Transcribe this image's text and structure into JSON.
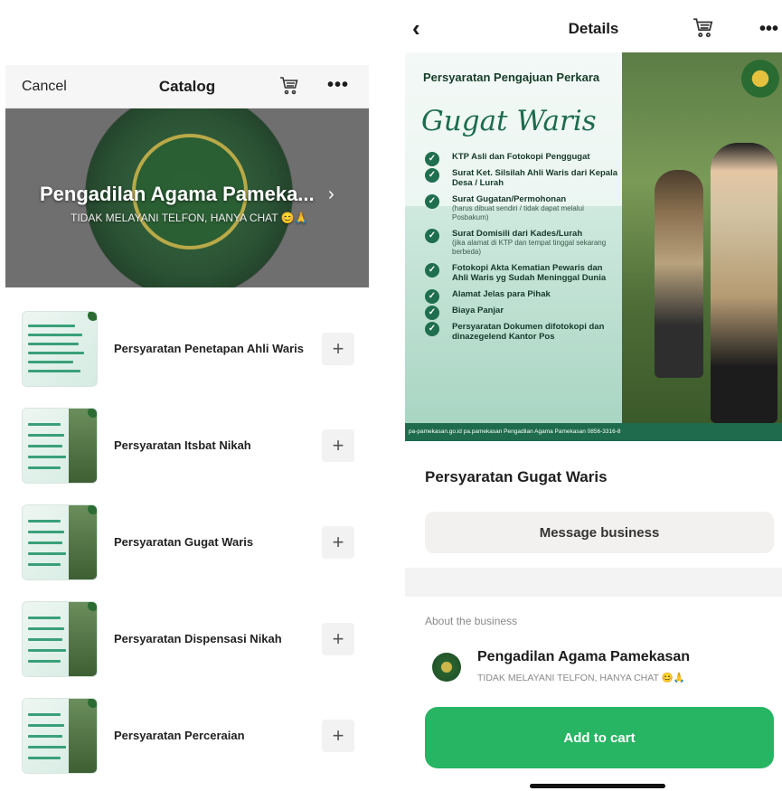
{
  "catalog": {
    "header": {
      "cancel_label": "Cancel",
      "title": "Catalog",
      "cart_icon": "cart-icon",
      "more_icon": "more-dots-icon"
    },
    "hero": {
      "business_name": "Pengadilan Agama Pameka...",
      "chevron": "›",
      "subtitle": "TIDAK MELAYANI TELFON, HANYA CHAT 😊🙏"
    },
    "items": [
      {
        "label": "Persyaratan Penetapan Ahli Waris",
        "add": "+"
      },
      {
        "label": "Persyaratan Itsbat Nikah",
        "add": "+"
      },
      {
        "label": "Persyaratan Gugat Waris",
        "add": "+"
      },
      {
        "label": "Persyaratan Dispensasi Nikah",
        "add": "+"
      },
      {
        "label": "Persyaratan Perceraian",
        "add": "+"
      }
    ]
  },
  "details": {
    "header": {
      "back": "‹",
      "title": "Details",
      "cart_icon": "cart-icon",
      "more_icon": "more-dots-icon"
    },
    "poster": {
      "heading": "Persyaratan Pengajuan Perkara",
      "script_title": "Gugat Waris",
      "requirements": [
        {
          "text": "KTP Asli dan Fotokopi Penggugat",
          "note": ""
        },
        {
          "text": "Surat Ket. Silsilah Ahli Waris dari Kepala Desa / Lurah",
          "note": ""
        },
        {
          "text": "Surat Gugatan/Permohonan",
          "note": "(harus dibuat sendiri / tidak dapat melalui Posbakum)"
        },
        {
          "text": "Surat Domisili dari Kades/Lurah",
          "note": "(jika alamat di KTP dan tempat tinggal sekarang berbeda)"
        },
        {
          "text": "Fotokopi Akta Kematian Pewaris dan Ahli Waris yg Sudah Meninggal Dunia",
          "note": ""
        },
        {
          "text": "Alamat Jelas para Pihak",
          "note": ""
        },
        {
          "text": "Biaya Panjar",
          "note": ""
        },
        {
          "text": "Persyaratan Dokumen difotokopi dan dinazegelend Kantor Pos",
          "note": ""
        }
      ],
      "footer": "pa-pamekasan.go.id   pa.pamekasan   Pengadilan Agama Pamekasan   0856-3316-8"
    },
    "product_title": "Persyaratan Gugat Waris",
    "message_button": "Message business",
    "about_label": "About the business",
    "business_name": "Pengadilan Agama Pamekasan",
    "business_subtitle": "TIDAK MELAYANI TELFON, HANYA CHAT 😊🙏",
    "add_to_cart": "Add to cart"
  },
  "colors": {
    "accent_green": "#27b563",
    "poster_green": "#1e6e4f"
  }
}
